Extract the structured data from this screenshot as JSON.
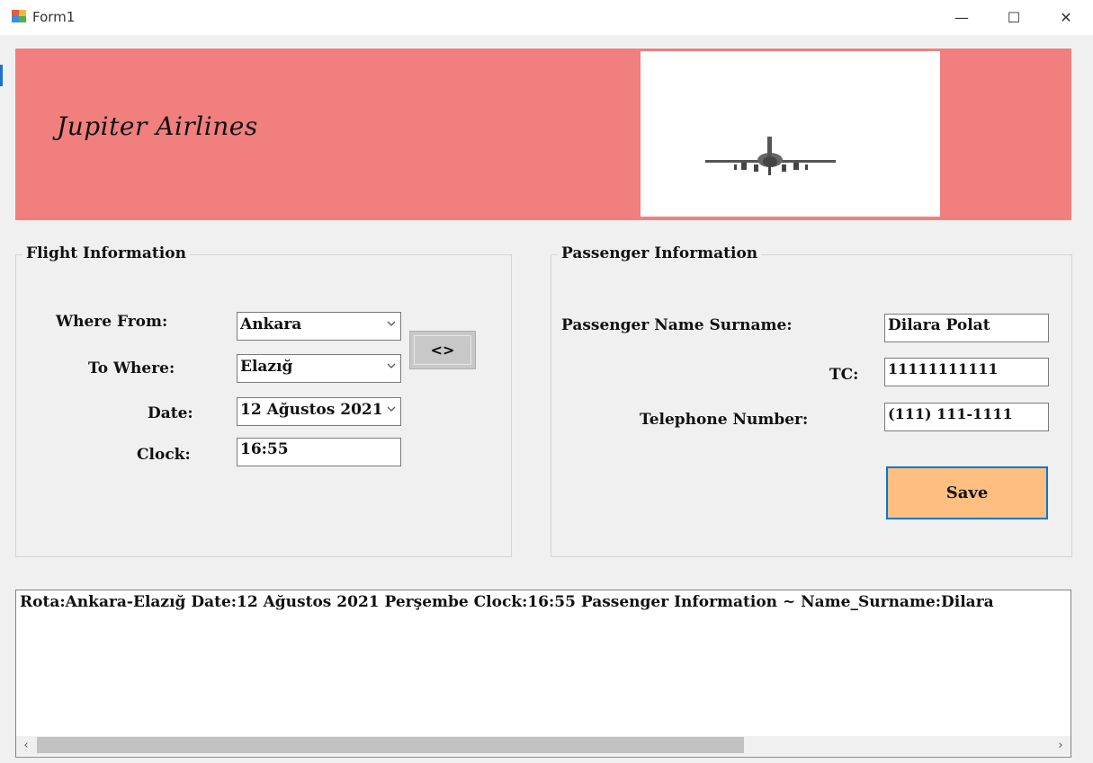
{
  "window": {
    "title": "Form1",
    "minimize": "—",
    "maximize": "☐",
    "close": "✕"
  },
  "banner": {
    "brand": "Jupiter Airlines",
    "image": "airplane-image",
    "color": "#f07f7d"
  },
  "flight": {
    "title": "Flight Information",
    "where_from_label": "Where From:",
    "where_from_value": "Ankara",
    "to_where_label": "To Where:",
    "to_where_value": "Elazığ",
    "date_label": "Date:",
    "date_value": "12 Ağustos 2021",
    "clock_label": "Clock:",
    "clock_value": "16:55",
    "swap_label": "<>"
  },
  "passenger": {
    "title": "Passenger Information",
    "name_label": "Passenger Name Surname:",
    "name_value": "Dilara Polat",
    "tc_label": "TC:",
    "tc_value": "11111111111",
    "phone_label": "Telephone Number:",
    "phone_value": "(111) 111-1111",
    "save_label": "Save",
    "save_color": "#ffbf80"
  },
  "output": {
    "text": "Rota:Ankara-Elazığ Date:12 Ağustos 2021 Perşembe Clock:16:55 Passenger Information ~ Name_Surname:Dilara",
    "scroll_left": "‹",
    "scroll_right": "›"
  }
}
